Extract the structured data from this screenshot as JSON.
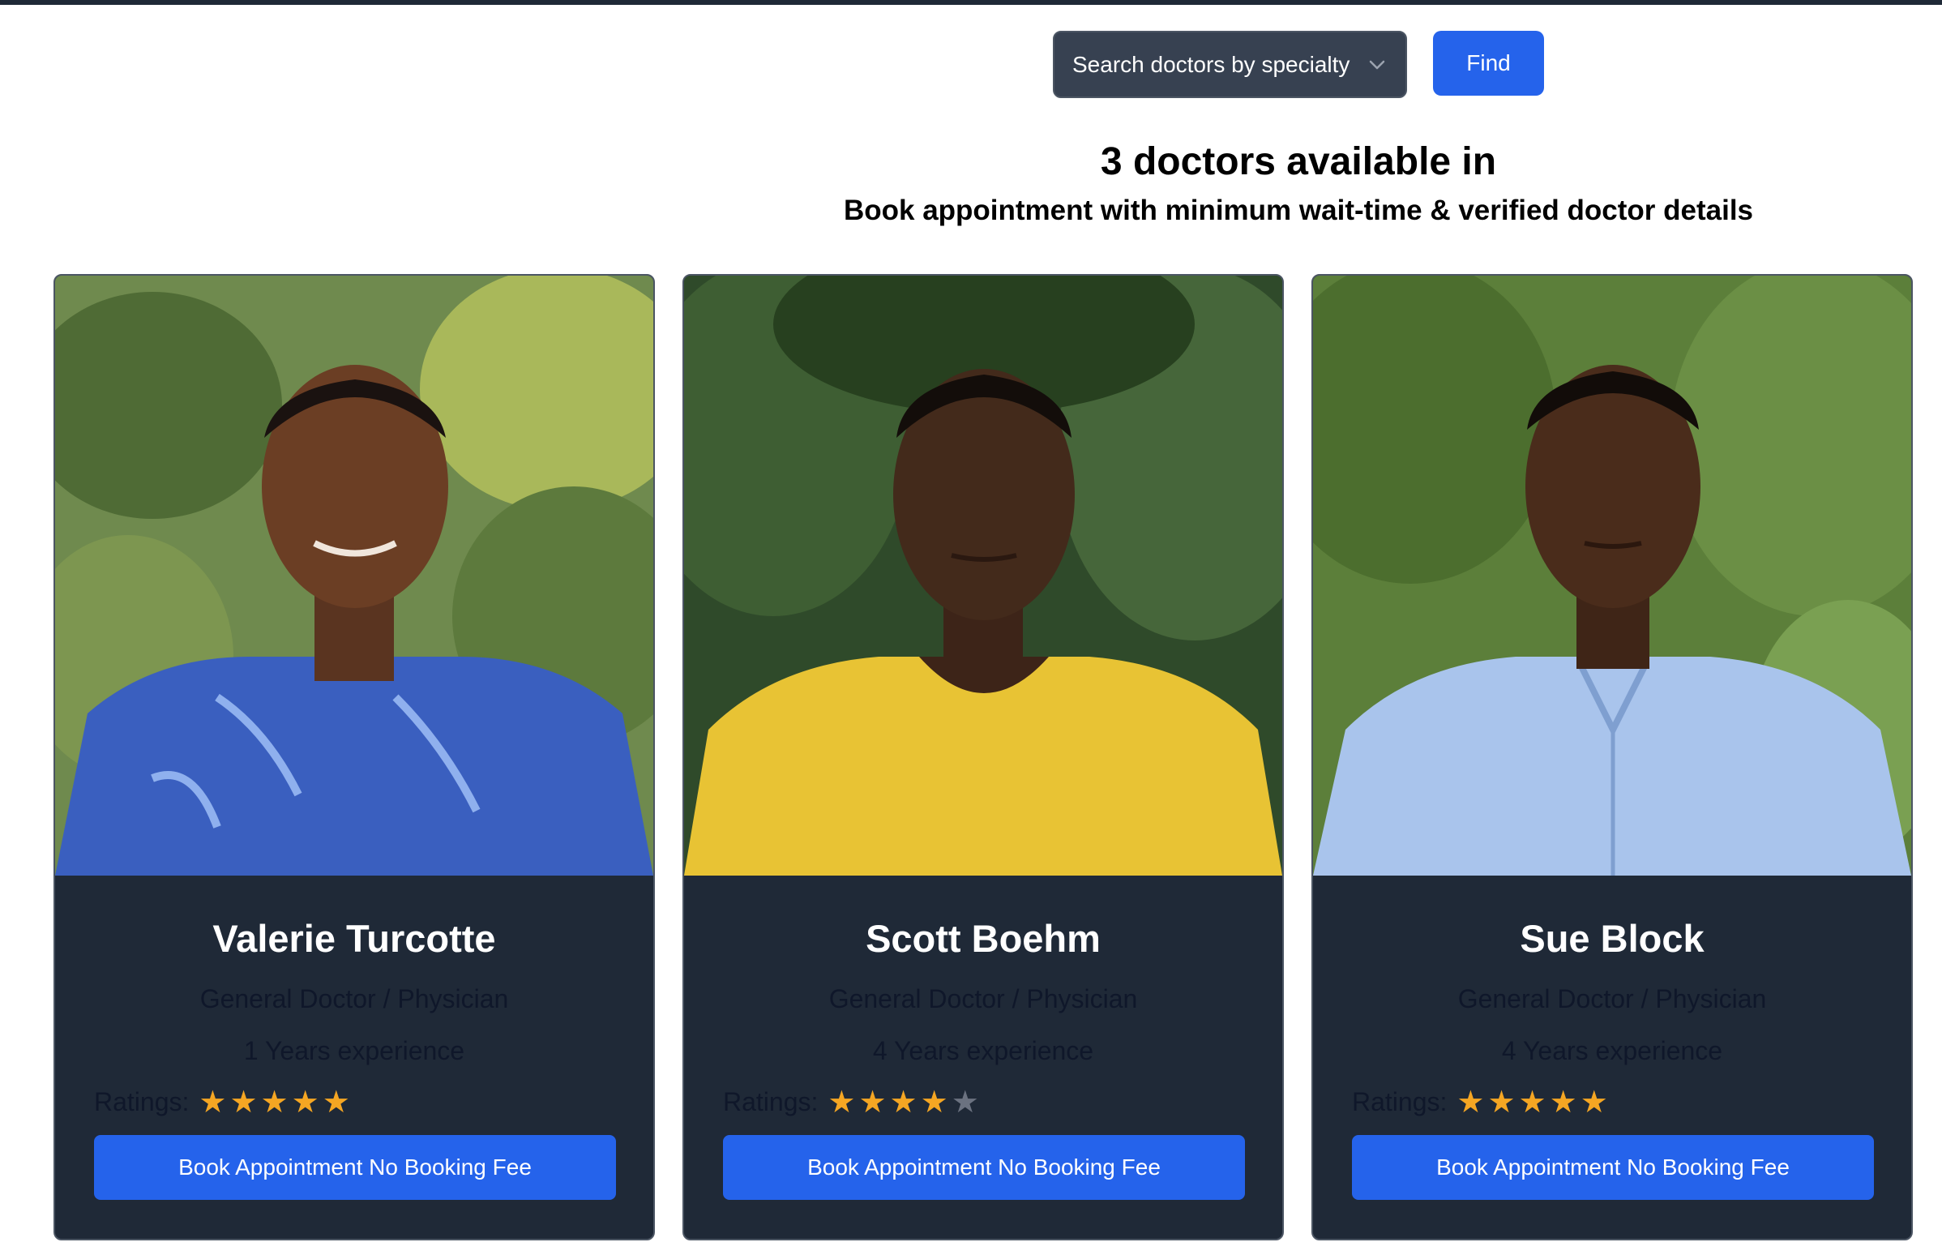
{
  "search": {
    "placeholder": "Search doctors by specialty",
    "find_label": "Find"
  },
  "results": {
    "heading": "3 doctors available in",
    "subheading": "Book appointment with minimum wait-time & verified doctor details"
  },
  "colors": {
    "accent": "#2563eb",
    "card_bg": "#1f2937",
    "star_on": "#f5a623",
    "star_off": "#6b7280"
  },
  "doctors": [
    {
      "name": "Valerie Turcotte",
      "specialty": "General Doctor / Physician",
      "experience": "1 Years experience",
      "ratings_label": "Ratings:",
      "rating": 5,
      "book_label": "Book Appointment No Booking Fee"
    },
    {
      "name": "Scott Boehm",
      "specialty": "General Doctor / Physician",
      "experience": "4 Years experience",
      "ratings_label": "Ratings:",
      "rating": 4,
      "book_label": "Book Appointment No Booking Fee"
    },
    {
      "name": "Sue Block",
      "specialty": "General Doctor / Physician",
      "experience": "4 Years experience",
      "ratings_label": "Ratings:",
      "rating": 5,
      "book_label": "Book Appointment No Booking Fee"
    }
  ]
}
